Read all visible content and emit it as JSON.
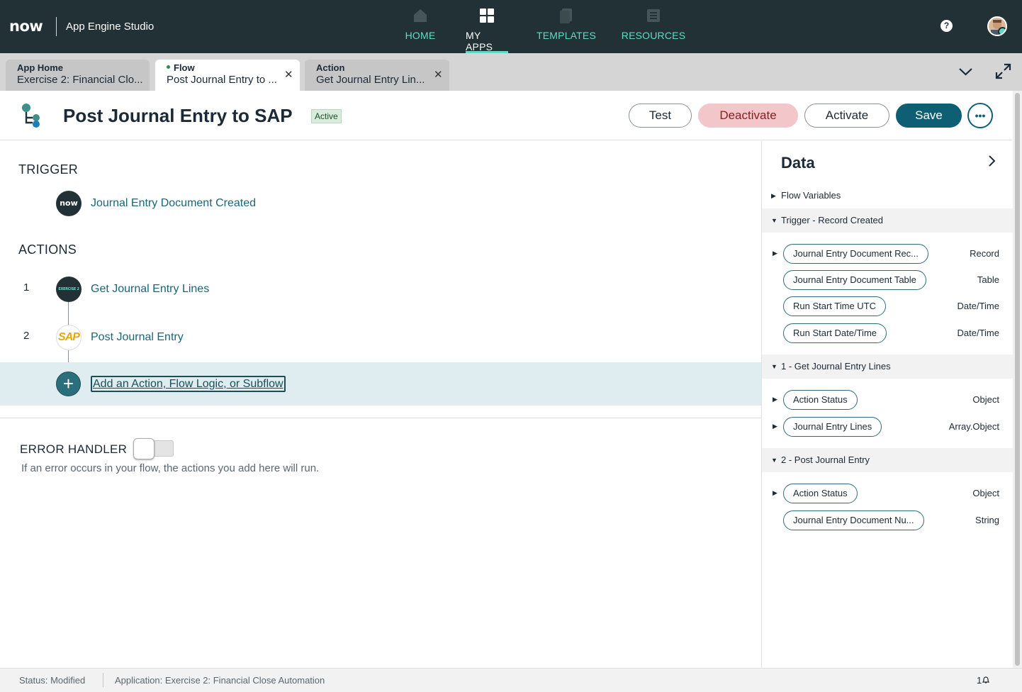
{
  "topbar": {
    "logo": "now",
    "app_title": "App Engine Studio",
    "nav": [
      {
        "label": "HOME",
        "icon": "home-icon"
      },
      {
        "label": "MY APPS",
        "icon": "grid-icon"
      },
      {
        "label": "TEMPLATES",
        "icon": "templates-icon"
      },
      {
        "label": "RESOURCES",
        "icon": "resources-icon"
      }
    ],
    "active_nav": "MY APPS",
    "help": "?"
  },
  "tabs": [
    {
      "type": "App Home",
      "title": "Exercise 2: Financial Clo..."
    },
    {
      "type": "Flow",
      "title": "Post Journal Entry to ..."
    },
    {
      "type": "Action",
      "title": "Get Journal Entry Lin..."
    }
  ],
  "header": {
    "title": "Post Journal Entry to SAP",
    "badge": "Active",
    "buttons": {
      "test": "Test",
      "deactivate": "Deactivate",
      "activate": "Activate",
      "save": "Save",
      "more": "•••"
    }
  },
  "flow": {
    "trigger_label": "TRIGGER",
    "trigger_icon_text": "now",
    "trigger_name": "Journal Entry Document Created",
    "actions_label": "ACTIONS",
    "actions": [
      {
        "num": "1",
        "name": "Get Journal Entry Lines",
        "icon_text": "EXERCISE 2"
      },
      {
        "num": "2",
        "name": "Post Journal Entry",
        "icon_text": "SAP"
      }
    ],
    "add_label": "Add an Action, Flow Logic, or Subflow",
    "error_label": "ERROR HANDLER",
    "error_desc": "If an error occurs in your flow, the actions you add here will run."
  },
  "data_panel": {
    "title": "Data",
    "groups": [
      {
        "label": "Flow Variables",
        "expanded": false
      },
      {
        "label": "Trigger - Record Created",
        "expanded": true,
        "items": [
          {
            "name": "Journal Entry Document Rec...",
            "type": "Record",
            "expandable": true
          },
          {
            "name": "Journal Entry Document Table",
            "type": "Table",
            "expandable": false
          },
          {
            "name": "Run Start Time UTC",
            "type": "Date/Time",
            "expandable": false
          },
          {
            "name": "Run Start Date/Time",
            "type": "Date/Time",
            "expandable": false
          }
        ]
      },
      {
        "label": "1 - Get Journal Entry Lines",
        "expanded": true,
        "items": [
          {
            "name": "Action Status",
            "type": "Object",
            "expandable": true
          },
          {
            "name": "Journal Entry Lines",
            "type": "Array.Object",
            "expandable": true
          }
        ]
      },
      {
        "label": "2 - Post Journal Entry",
        "expanded": true,
        "items": [
          {
            "name": "Action Status",
            "type": "Object",
            "expandable": true
          },
          {
            "name": "Journal Entry Document Nu...",
            "type": "String",
            "expandable": false
          }
        ]
      }
    ]
  },
  "status_bar": {
    "status": "Status: Modified",
    "application": "Application: Exercise 2: Financial Close Automation",
    "notifications": "1"
  },
  "colors": {
    "topbar": "#213135",
    "accent": "#62d9c7",
    "primary": "#0f5f74",
    "danger_bg": "#f3c7c9"
  }
}
